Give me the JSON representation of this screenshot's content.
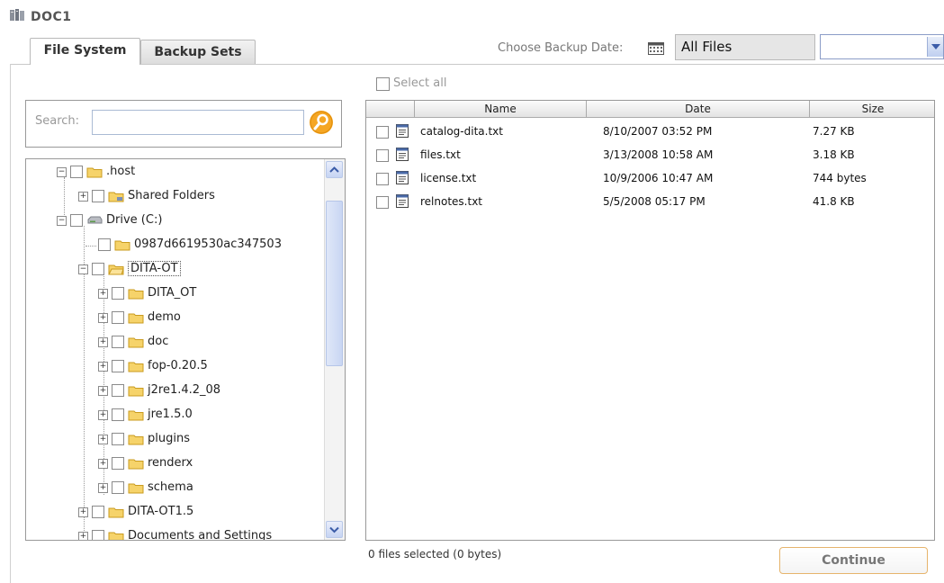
{
  "window": {
    "title": "DOC1"
  },
  "tabs": [
    {
      "label": "File System",
      "active": true
    },
    {
      "label": "Backup Sets",
      "active": false
    }
  ],
  "backup_date": {
    "label": "Choose Backup Date:",
    "value": "All Files",
    "second_select": ""
  },
  "search": {
    "label": "Search:",
    "value": ""
  },
  "tree": [
    {
      "label": ".host"
    },
    {
      "label": "Shared Folders"
    },
    {
      "label": "Drive (C:)"
    },
    {
      "label": "0987d6619530ac347503"
    },
    {
      "label": "DITA-OT"
    },
    {
      "label": "DITA_OT"
    },
    {
      "label": "demo"
    },
    {
      "label": "doc"
    },
    {
      "label": "fop-0.20.5"
    },
    {
      "label": "j2re1.4.2_08"
    },
    {
      "label": "jre1.5.0"
    },
    {
      "label": "plugins"
    },
    {
      "label": "renderx"
    },
    {
      "label": "schema"
    },
    {
      "label": "DITA-OT1.5"
    },
    {
      "label": "Documents and Settings"
    }
  ],
  "select_all": {
    "label": "Select all"
  },
  "file_table": {
    "columns": [
      "Name",
      "Date",
      "Size"
    ],
    "rows": [
      {
        "name": "catalog-dita.txt",
        "date": "8/10/2007 03:52 PM",
        "size": "7.27 KB"
      },
      {
        "name": "files.txt",
        "date": "3/13/2008 10:58 AM",
        "size": "3.18 KB"
      },
      {
        "name": "license.txt",
        "date": "10/9/2006 10:47 AM",
        "size": "744 bytes"
      },
      {
        "name": "relnotes.txt",
        "date": "5/5/2008 05:17 PM",
        "size": "41.8 KB"
      }
    ]
  },
  "status": {
    "text": "0 files selected (0 bytes)"
  },
  "continue": {
    "label": "Continue"
  },
  "colors": {
    "accent_orange": "#f5a623",
    "folder_yellow": "#f2c94c",
    "border": "#999999"
  }
}
